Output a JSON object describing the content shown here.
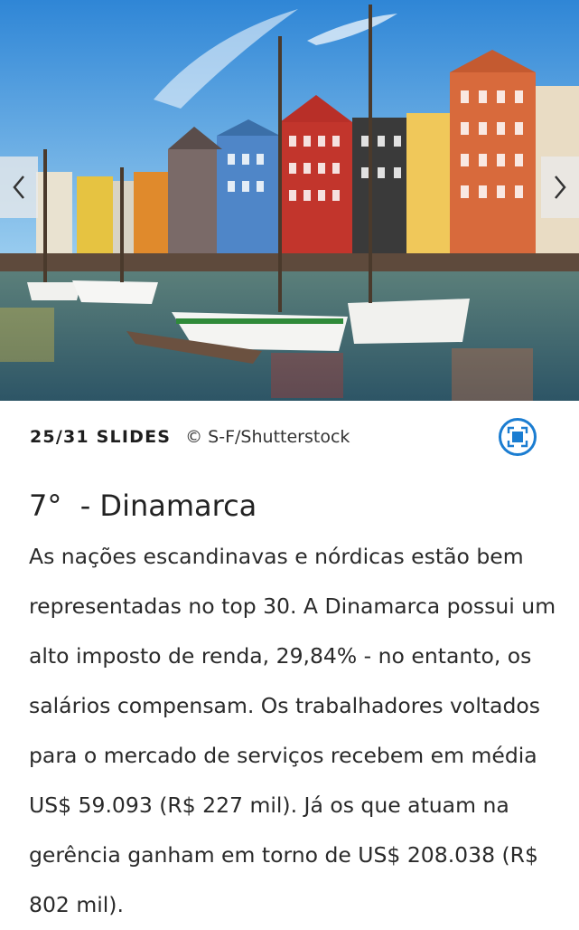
{
  "slideshow": {
    "image_alt": "Nyhavn, Copenhagen",
    "prev_label": "Previous",
    "next_label": "Next",
    "counter": "25/31 SLIDES",
    "credit": "© S-F/Shutterstock",
    "fullscreen_label": "Full screen"
  },
  "article": {
    "title": "7°  - Dinamarca",
    "body": "As nações escandinavas e nórdicas estão bem representadas no top 30. A Dinamarca possui um alto imposto de renda, 29,84% - no entanto, os salários compensam. Os trabalhadores voltados para o mercado de serviços recebem em média US$ 59.093 (R$ 227 mil). Já os que atuam na gerência ganham em torno de US$ 208.038 (R$ 802 mil)."
  },
  "colors": {
    "accent": "#1b7dd1",
    "sky": "#5aa6de",
    "water": "#3b6e80"
  }
}
